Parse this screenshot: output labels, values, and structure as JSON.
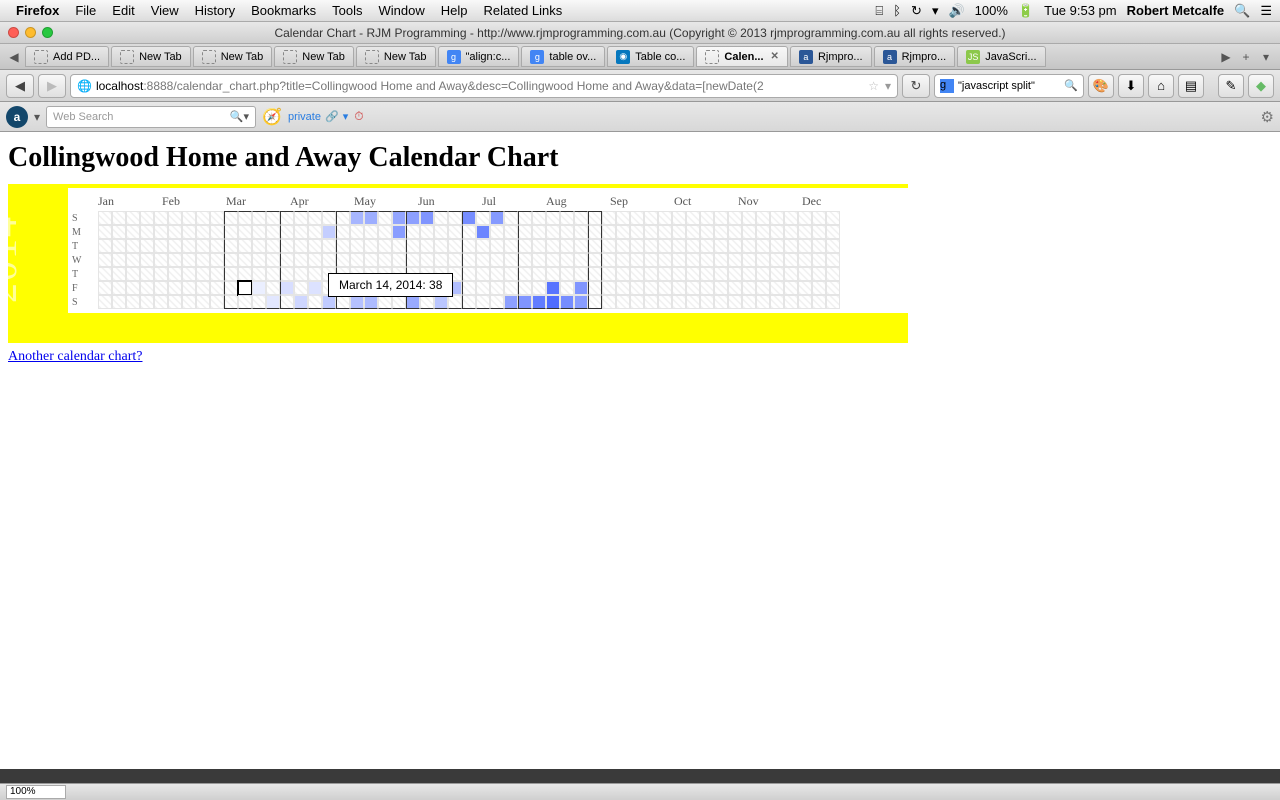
{
  "menubar": {
    "apple": "",
    "app": "Firefox",
    "items": [
      "File",
      "Edit",
      "View",
      "History",
      "Bookmarks",
      "Tools",
      "Window",
      "Help",
      "Related Links"
    ],
    "battery": "100%",
    "clock": "Tue 9:53 pm",
    "user": "Robert Metcalfe"
  },
  "window": {
    "title": "Calendar Chart - RJM Programming - http://www.rjmprogramming.com.au (Copyright © 2013 rjmprogramming.com.au all rights reserved.)"
  },
  "tabs": [
    {
      "label": "Add PD...",
      "fav": "dashed"
    },
    {
      "label": "New Tab",
      "fav": "dashed"
    },
    {
      "label": "New Tab",
      "fav": "dashed"
    },
    {
      "label": "New Tab",
      "fav": "dashed"
    },
    {
      "label": "New Tab",
      "fav": "dashed"
    },
    {
      "label": "\"align:c...",
      "fav": "g"
    },
    {
      "label": "table ov...",
      "fav": "g"
    },
    {
      "label": "Table co...",
      "fav": "d"
    },
    {
      "label": "Calen...",
      "fav": "dashed",
      "active": true,
      "close": true
    },
    {
      "label": "Rjmpro...",
      "fav": "r"
    },
    {
      "label": "Rjmpro...",
      "fav": "r"
    },
    {
      "label": "JavaScri...",
      "fav": "j"
    }
  ],
  "url": {
    "host": "localhost",
    "port": ":8888",
    "path": "/calendar_chart.php?title=Collingwood Home and Away&desc=Collingwood Home and Away&data=[newDate(2"
  },
  "search": {
    "engine": "g",
    "query": "\"javascript split\""
  },
  "toolbar2": {
    "placeholder": "Web Search",
    "private": "private"
  },
  "page": {
    "heading": "Collingwood Home and Away Calendar Chart",
    "link": "Another calendar chart?"
  },
  "chart_data": {
    "type": "calendar-heatmap",
    "year": "2014",
    "months": [
      "Jan",
      "Feb",
      "Mar",
      "Apr",
      "May",
      "Jun",
      "Jul",
      "Aug",
      "Sep",
      "Oct",
      "Nov",
      "Dec"
    ],
    "weekdays": [
      "S",
      "M",
      "T",
      "W",
      "T",
      "F",
      "S"
    ],
    "legend_min": 30,
    "tooltip": "March 14, 2014: 38",
    "highlighted": {
      "week": 10,
      "day": 5
    },
    "season_start_week": 9,
    "season_end_week": 35,
    "entries": [
      {
        "week": 10,
        "day": 5,
        "value": 38
      },
      {
        "week": 11,
        "day": 5,
        "value": 40
      },
      {
        "week": 12,
        "day": 6,
        "value": 45
      },
      {
        "week": 13,
        "day": 5,
        "value": 50
      },
      {
        "week": 14,
        "day": 6,
        "value": 55
      },
      {
        "week": 15,
        "day": 5,
        "value": 48
      },
      {
        "week": 16,
        "day": 1,
        "value": 60
      },
      {
        "week": 16,
        "day": 6,
        "value": 62
      },
      {
        "week": 17,
        "day": 5,
        "value": 70
      },
      {
        "week": 18,
        "day": 0,
        "value": 75
      },
      {
        "week": 18,
        "day": 6,
        "value": 68
      },
      {
        "week": 19,
        "day": 0,
        "value": 80
      },
      {
        "week": 19,
        "day": 6,
        "value": 72
      },
      {
        "week": 20,
        "day": 5,
        "value": 78
      },
      {
        "week": 21,
        "day": 0,
        "value": 85
      },
      {
        "week": 21,
        "day": 1,
        "value": 90
      },
      {
        "week": 22,
        "day": 0,
        "value": 88
      },
      {
        "week": 22,
        "day": 6,
        "value": 82
      },
      {
        "week": 23,
        "day": 0,
        "value": 95
      },
      {
        "week": 24,
        "day": 5,
        "value": 60
      },
      {
        "week": 24,
        "day": 6,
        "value": 65
      },
      {
        "week": 25,
        "day": 5,
        "value": 70
      },
      {
        "week": 26,
        "day": 0,
        "value": 100
      },
      {
        "week": 27,
        "day": 1,
        "value": 105
      },
      {
        "week": 28,
        "day": 0,
        "value": 92
      },
      {
        "week": 29,
        "day": 6,
        "value": 88
      },
      {
        "week": 30,
        "day": 6,
        "value": 95
      },
      {
        "week": 31,
        "day": 6,
        "value": 110
      },
      {
        "week": 32,
        "day": 5,
        "value": 115
      },
      {
        "week": 32,
        "day": 6,
        "value": 120
      },
      {
        "week": 33,
        "day": 6,
        "value": 100
      },
      {
        "week": 34,
        "day": 5,
        "value": 95
      },
      {
        "week": 34,
        "day": 6,
        "value": 90
      }
    ]
  },
  "status": {
    "zoom": "100%"
  }
}
